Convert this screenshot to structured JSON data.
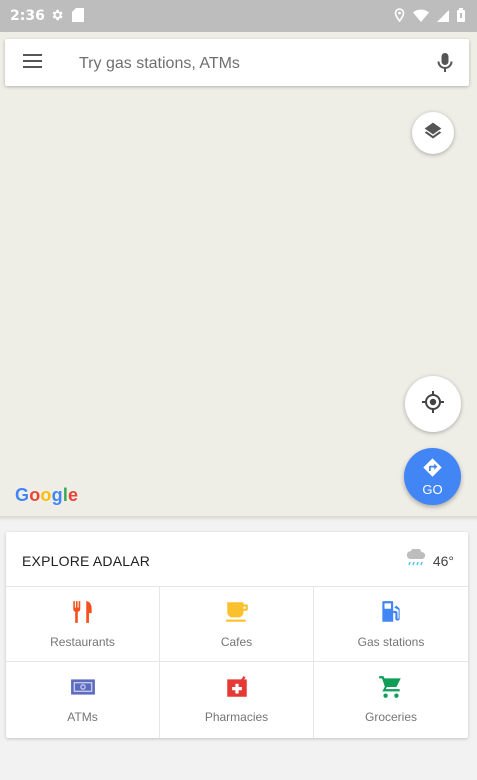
{
  "status_bar": {
    "time": "2:36"
  },
  "search": {
    "placeholder": "Try gas stations, ATMs"
  },
  "go_button": {
    "label": "GO"
  },
  "logo": {
    "letters": [
      "G",
      "o",
      "o",
      "g",
      "l",
      "e"
    ],
    "colors": [
      "#4285f4",
      "#ea4335",
      "#fbbc05",
      "#4285f4",
      "#34a853",
      "#ea4335"
    ]
  },
  "explore": {
    "title": "EXPLORE ADALAR",
    "weather_temp": "46°",
    "categories": [
      {
        "label": "Restaurants",
        "icon": "restaurant-icon",
        "color": "#f4511e"
      },
      {
        "label": "Cafes",
        "icon": "cafe-icon",
        "color": "#fbc02d"
      },
      {
        "label": "Gas stations",
        "icon": "gas-station-icon",
        "color": "#4285f4"
      },
      {
        "label": "ATMs",
        "icon": "atm-icon",
        "color": "#5c6bc0"
      },
      {
        "label": "Pharmacies",
        "icon": "pharmacy-icon",
        "color": "#e53935"
      },
      {
        "label": "Groceries",
        "icon": "grocery-cart-icon",
        "color": "#0f9d58"
      }
    ]
  }
}
